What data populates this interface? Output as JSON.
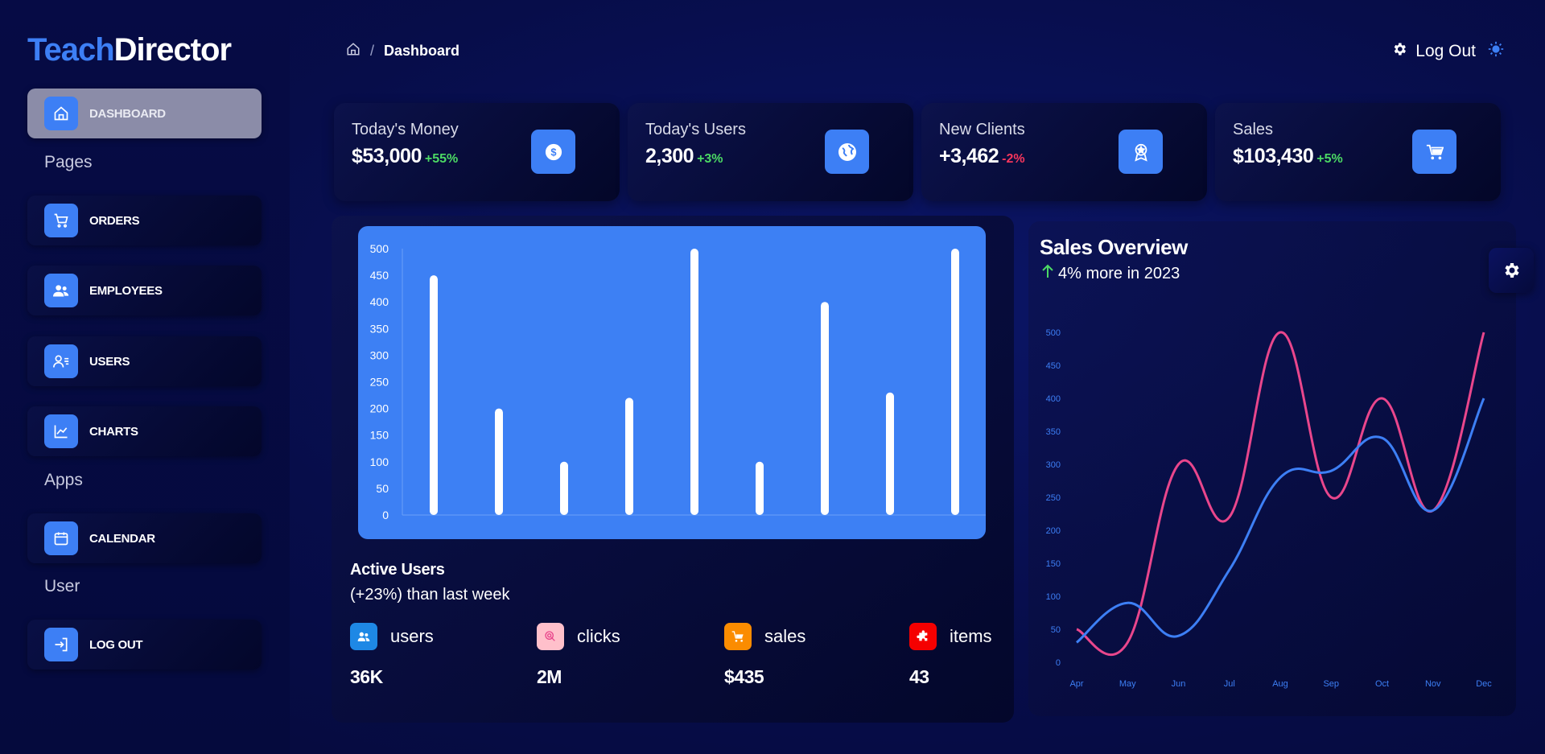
{
  "brand": {
    "part1": "Teach",
    "part2": "Director"
  },
  "sidebar": {
    "active": {
      "label": "DASHBOARD",
      "icon": "home-icon"
    },
    "sections": {
      "pages": "Pages",
      "apps": "Apps",
      "user": "User"
    },
    "items": [
      {
        "label": "ORDERS",
        "icon": "cart-icon"
      },
      {
        "label": "EMPLOYEES",
        "icon": "employees-icon"
      },
      {
        "label": "USERS",
        "icon": "users-icon"
      },
      {
        "label": "CHARTS",
        "icon": "chart-line-icon"
      },
      {
        "label": "CALENDAR",
        "icon": "calendar-icon"
      },
      {
        "label": "LOG OUT",
        "icon": "logout-icon"
      }
    ]
  },
  "header": {
    "breadcrumb_current": "Dashboard",
    "logout_label": "Log Out"
  },
  "stats": [
    {
      "title": "Today's Money",
      "value": "$53,000",
      "change": "+55%",
      "change_color": "#4cd964",
      "icon": "dollar-icon"
    },
    {
      "title": "Today's Users",
      "value": "2,300",
      "change": "+3%",
      "change_color": "#4cd964",
      "icon": "globe-icon"
    },
    {
      "title": "New Clients",
      "value": "+3,462",
      "change": "-2%",
      "change_color": "#f5365c",
      "icon": "award-icon"
    },
    {
      "title": "Sales",
      "value": "$103,430",
      "change": "+5%",
      "change_color": "#4cd964",
      "icon": "cart-icon"
    }
  ],
  "active_users": {
    "title": "Active Users",
    "subtitle": "(+23%) than last week",
    "metrics": [
      {
        "label": "users",
        "value": "36K",
        "color": "#1e88e5",
        "icon": "users-icon"
      },
      {
        "label": "clicks",
        "value": "2M",
        "color": "#ffc0cb",
        "icon": "click-icon"
      },
      {
        "label": "sales",
        "value": "$435",
        "color": "#fb8c00",
        "icon": "cart-icon"
      },
      {
        "label": "items",
        "value": "43",
        "color": "#f50000",
        "icon": "puzzle-icon"
      }
    ]
  },
  "sales_overview": {
    "title": "Sales Overview",
    "subtitle": "4% more in 2023"
  },
  "chart_data": [
    {
      "type": "bar",
      "categories": [
        "",
        "",
        "",
        "",
        "",
        "",
        "",
        "",
        ""
      ],
      "values": [
        450,
        200,
        100,
        220,
        500,
        100,
        400,
        230,
        500
      ],
      "ylim": [
        0,
        500
      ],
      "yticks": [
        0,
        50,
        100,
        150,
        200,
        250,
        300,
        350,
        400,
        450,
        500
      ],
      "color": "#ffffff",
      "grid": false
    },
    {
      "type": "line",
      "x": [
        "Apr",
        "May",
        "Jun",
        "Jul",
        "Aug",
        "Sep",
        "Oct",
        "Nov",
        "Dec"
      ],
      "ylim": [
        0,
        500
      ],
      "yticks": [
        0,
        50,
        100,
        150,
        200,
        250,
        300,
        350,
        400,
        450,
        500
      ],
      "series": [
        {
          "values": [
            50,
            30,
            300,
            220,
            500,
            250,
            400,
            230,
            500
          ],
          "color": "#e9468c"
        },
        {
          "values": [
            30,
            90,
            40,
            140,
            280,
            290,
            340,
            230,
            400
          ],
          "color": "#3d7ff5"
        }
      ],
      "grid": false
    }
  ]
}
